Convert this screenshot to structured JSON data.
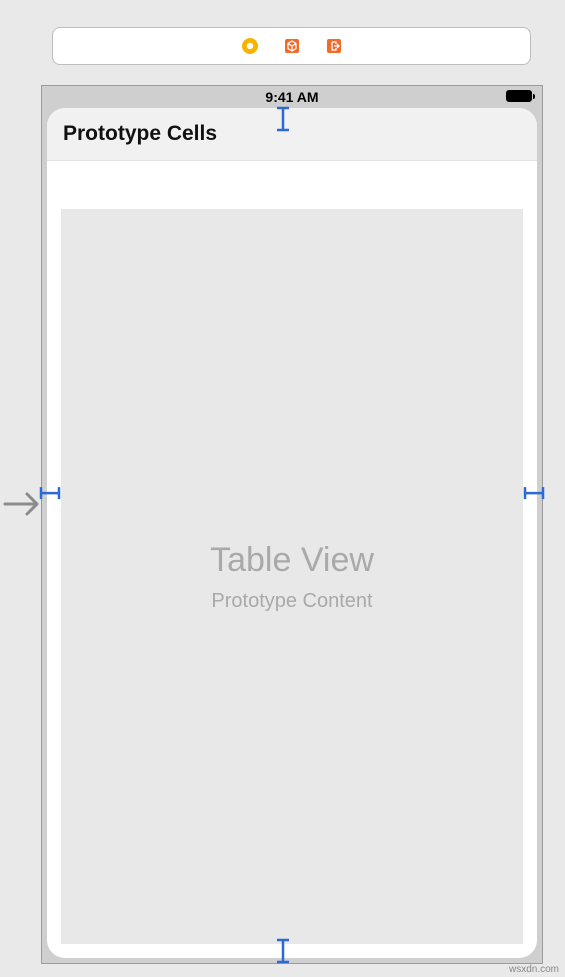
{
  "toolbar": {
    "icons": {
      "coin": "coin-icon",
      "cube": "cube-icon",
      "exit": "exit-icon"
    }
  },
  "statusBar": {
    "time": "9:41 AM"
  },
  "tableView": {
    "sectionHeader": "Prototype Cells",
    "placeholderTitle": "Table View",
    "placeholderSubtitle": "Prototype Content"
  },
  "watermark": "wsxdn.com"
}
